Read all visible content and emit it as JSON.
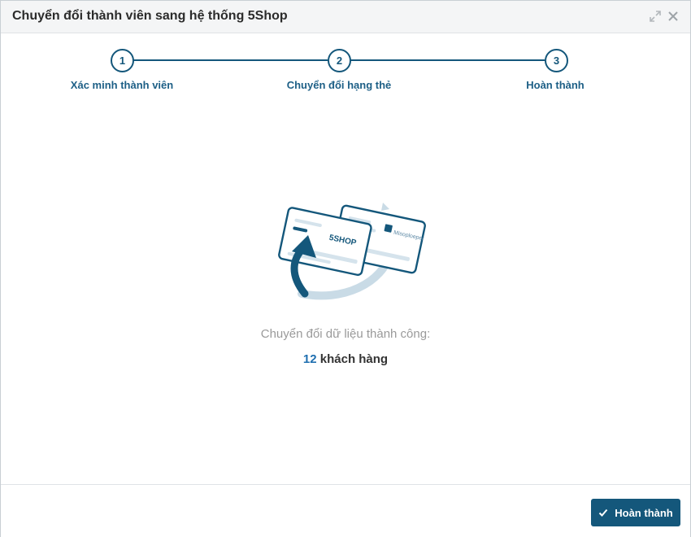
{
  "dialog": {
    "title": "Chuyển đổi thành viên sang hệ thống 5Shop",
    "expand_icon": "expand-icon",
    "close_icon": "close-icon"
  },
  "steps": [
    {
      "number": "1",
      "label": "Xác minh thành viên"
    },
    {
      "number": "2",
      "label": "Chuyển đổi hạng thẻ"
    },
    {
      "number": "3",
      "label": "Hoàn thành"
    }
  ],
  "illustration": {
    "front_card_brand": "5SHOP",
    "back_card_brand": "Misoploeper"
  },
  "result": {
    "message": "Chuyển đổi dữ liệu thành công:",
    "count": "12",
    "count_unit": "khách hàng"
  },
  "footer": {
    "finish_label": "Hoàn thành"
  },
  "colors": {
    "primary": "#14577b",
    "count": "#1f6fb0"
  }
}
